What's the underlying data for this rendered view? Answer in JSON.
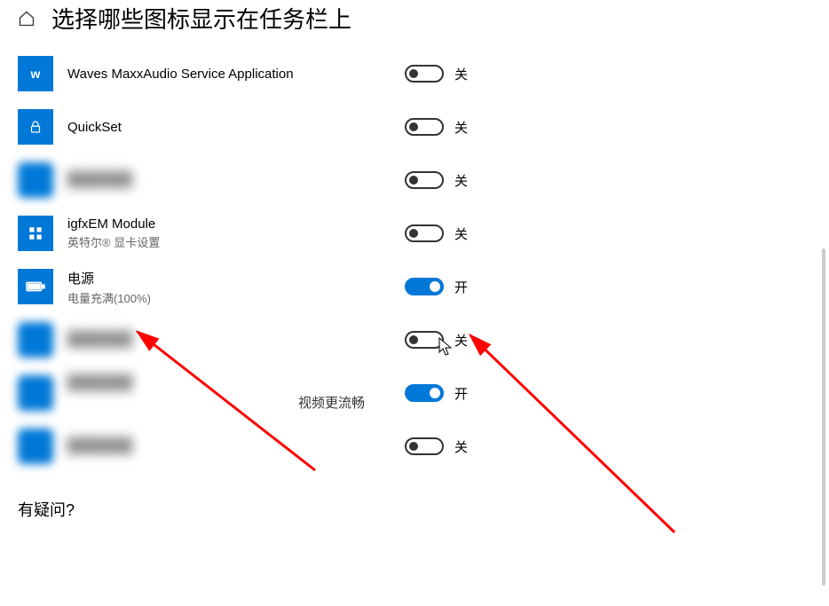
{
  "header": {
    "title": "选择哪些图标显示在任务栏上"
  },
  "items": [
    {
      "title": "Waves MaxxAudio Service Application",
      "sub": "",
      "state": "off",
      "label": "关",
      "icon_letter": "w",
      "blurred": false
    },
    {
      "title": "QuickSet",
      "sub": "",
      "state": "off",
      "label": "关",
      "icon_letter": "",
      "icon_svg": "lock",
      "blurred": false
    },
    {
      "title": "",
      "sub": "",
      "state": "off",
      "label": "关",
      "blurred": true
    },
    {
      "title": "igfxEM Module",
      "sub": "英特尔® 显卡设置",
      "state": "off",
      "label": "关",
      "icon_svg": "grid",
      "blurred": false
    },
    {
      "title": "电源",
      "sub": "电量充满(100%)",
      "state": "on",
      "label": "开",
      "icon_svg": "battery",
      "blurred": false
    },
    {
      "title": "",
      "sub": "",
      "state": "off",
      "label": "关",
      "blurred": true
    },
    {
      "title": "",
      "sub": "",
      "state": "on",
      "label": "开",
      "blurred": true,
      "extra_text": "视频更流畅"
    },
    {
      "title": "",
      "sub": "",
      "state": "off",
      "label": "关",
      "blurred": true
    }
  ],
  "footer": {
    "question": "有疑问?"
  },
  "toggle_labels": {
    "on": "开",
    "off": "关"
  }
}
